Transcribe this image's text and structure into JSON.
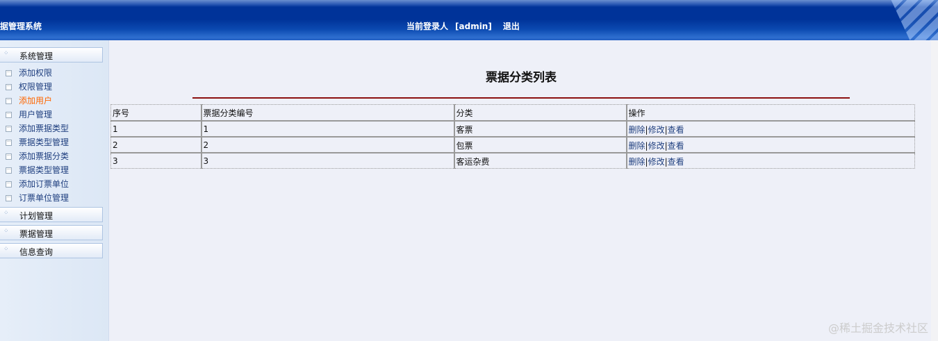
{
  "header": {
    "title": "据管理系统",
    "login_label": "当前登录人",
    "user": "[admin]",
    "logout": "退出"
  },
  "sidebar": {
    "groups": [
      {
        "label": "系统管理"
      },
      {
        "label": "计划管理"
      },
      {
        "label": "票据管理"
      },
      {
        "label": "信息查询"
      }
    ],
    "items": [
      {
        "label": "添加权限"
      },
      {
        "label": "权限管理"
      },
      {
        "label": "添加用户",
        "active": true
      },
      {
        "label": "用户管理"
      },
      {
        "label": "添加票据类型"
      },
      {
        "label": "票据类型管理"
      },
      {
        "label": "添加票据分类"
      },
      {
        "label": "票据类型管理"
      },
      {
        "label": "添加订票单位"
      },
      {
        "label": "订票单位管理"
      }
    ]
  },
  "main": {
    "title": "票据分类列表",
    "columns": [
      "序号",
      "票据分类编号",
      "分类",
      "操作"
    ],
    "rows": [
      {
        "no": "1",
        "code": "1",
        "category": "客票"
      },
      {
        "no": "2",
        "code": "2",
        "category": "包票"
      },
      {
        "no": "3",
        "code": "3",
        "category": "客运杂费"
      }
    ],
    "actions": {
      "delete": "删除",
      "sep": "|",
      "edit": "修改",
      "view": "查看"
    }
  },
  "watermark": "@稀土掘金技术社区"
}
